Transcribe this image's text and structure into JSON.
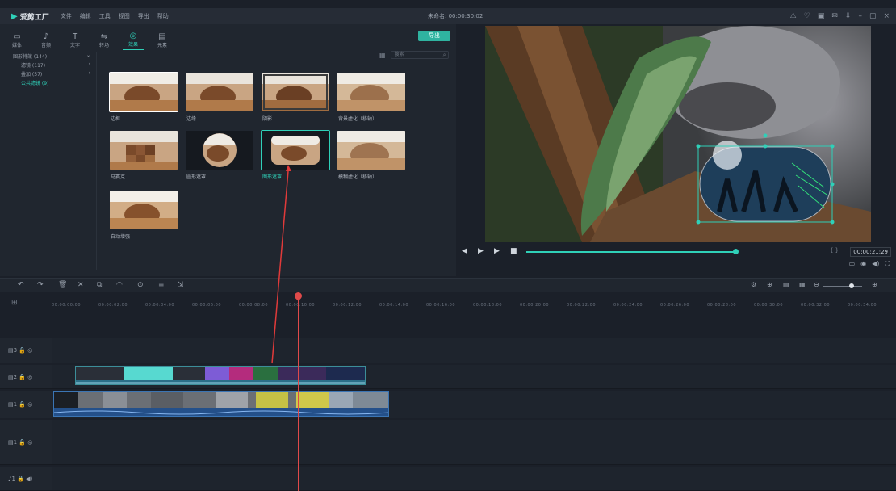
{
  "titlebar": {
    "app_name": "爱剪工厂",
    "menu": [
      "文件",
      "编辑",
      "工具",
      "视图",
      "导出",
      "帮助"
    ],
    "project_title": "未命名: 00:00:30:02",
    "window_icons": [
      "⚠",
      "♡",
      "▣",
      "✉",
      "⇩",
      "–",
      "▢",
      "×"
    ]
  },
  "toolbar": {
    "tabs": [
      {
        "label": "媒体",
        "icon": "folder-icon",
        "glyph": "▭"
      },
      {
        "label": "音频",
        "icon": "music-icon",
        "glyph": "♪"
      },
      {
        "label": "文字",
        "icon": "text-icon",
        "glyph": "T"
      },
      {
        "label": "转场",
        "icon": "transition-icon",
        "glyph": "⇋"
      },
      {
        "label": "效果",
        "icon": "effects-icon",
        "glyph": "◎"
      },
      {
        "label": "元素",
        "icon": "elements-icon",
        "glyph": "▤"
      }
    ],
    "export_label": "导出"
  },
  "categories": [
    {
      "label": "图形特效 (144)",
      "count": "",
      "sub": false,
      "active": false
    },
    {
      "label": "滤镜 (117)",
      "count": "›",
      "sub": true,
      "active": false
    },
    {
      "label": "叠加 (57)",
      "count": "›",
      "sub": true,
      "active": false
    },
    {
      "label": "公共滤镜 (9)",
      "count": "",
      "sub": true,
      "active": true
    }
  ],
  "search": {
    "placeholder": "搜索"
  },
  "thumbnails": [
    {
      "label": "边框",
      "selected": true,
      "style": "plain"
    },
    {
      "label": "边缘",
      "selected": false,
      "style": "plain"
    },
    {
      "label": "阴影",
      "selected": false,
      "style": "plain"
    },
    {
      "label": "背景虚化（移轴）",
      "selected": false,
      "style": "plain"
    },
    {
      "label": "马赛克",
      "selected": false,
      "style": "plain"
    },
    {
      "label": "圆形遮罩",
      "selected": false,
      "style": "circle"
    },
    {
      "label": "图形遮罩",
      "selected": false,
      "style": "shape",
      "active": true
    },
    {
      "label": "模糊虚化（移轴）",
      "selected": false,
      "style": "plain"
    },
    {
      "label": "自动增强",
      "selected": false,
      "style": "plain"
    }
  ],
  "player": {
    "timecode": "00:00:21:29",
    "brackets": "{  }",
    "progress": 0.99,
    "controls": [
      "◀",
      "▶",
      "▶",
      "■"
    ],
    "extra_icons": [
      "▭",
      "◉",
      "◀)",
      "⛶"
    ]
  },
  "timeline": {
    "tools": [
      "↶",
      "↷",
      "🗑",
      "✕",
      "⧉",
      "◠",
      "⊙",
      "≡",
      "⇲"
    ],
    "right_tools": [
      "⚙",
      "⊕",
      "▤",
      "▦",
      "⊖",
      "⊕"
    ],
    "ruler_ticks": [
      "00:00:00:00",
      "00:00:02:00",
      "00:00:04:00",
      "00:00:06:00",
      "00:00:08:00",
      "00:00:10:00",
      "00:00:12:00",
      "00:00:14:00",
      "00:00:16:00",
      "00:00:18:00",
      "00:00:20:00",
      "00:00:22:00",
      "00:00:24:00",
      "00:00:26:00",
      "00:00:28:00",
      "00:00:30:00",
      "00:00:32:00",
      "00:00:34:00"
    ],
    "track_heads": [
      "▤3 🔒 ◎",
      "▤2 🔒 ◎",
      "▤1 🔒 ◎",
      "▤1 🔒 ◎",
      "♪1 🔒 ◀)"
    ]
  }
}
